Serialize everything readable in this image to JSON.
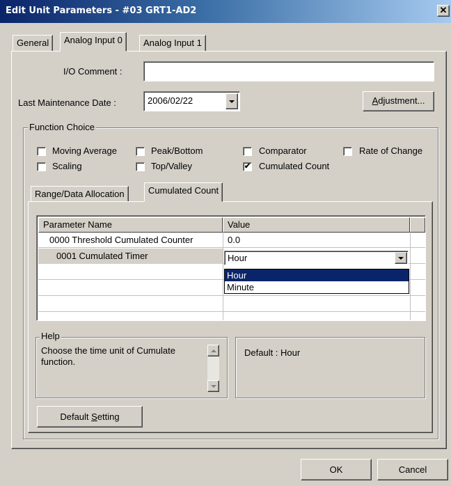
{
  "window": {
    "title": "Edit Unit Parameters - #03 GRT1-AD2",
    "close_glyph": "✕"
  },
  "tabs": [
    {
      "label": "General"
    },
    {
      "label": "Analog Input 0"
    },
    {
      "label": "Analog Input 1"
    }
  ],
  "io_comment": {
    "label": "I/O Comment :",
    "value": ""
  },
  "maintenance": {
    "label": "Last Maintenance Date :",
    "value": "2006/02/22"
  },
  "adjustment_button": {
    "pre": "",
    "mnemonic": "A",
    "post": "djustment..."
  },
  "function_choice": {
    "title": "Function Choice",
    "options": [
      {
        "label": "Moving Average",
        "checked": false
      },
      {
        "label": "Peak/Bottom",
        "checked": false
      },
      {
        "label": "Comparator",
        "checked": false
      },
      {
        "label": "Rate of Change",
        "checked": false
      },
      {
        "label": "Scaling",
        "checked": false
      },
      {
        "label": "Top/Valley",
        "checked": false
      },
      {
        "label": "Cumulated Count",
        "checked": true
      }
    ]
  },
  "subtabs": [
    {
      "label": "Range/Data Allocation"
    },
    {
      "label": "Cumulated Count"
    }
  ],
  "grid": {
    "headers": [
      "Parameter Name",
      "Value"
    ],
    "rows": [
      {
        "name": "0000 Threshold Cumulated Counter",
        "value": "0.0"
      },
      {
        "name": "0001 Cumulated Timer",
        "value": "Hour"
      }
    ],
    "dropdown_options": [
      {
        "label": "Hour",
        "selected": true
      },
      {
        "label": "Minute",
        "selected": false
      }
    ]
  },
  "help": {
    "title": "Help",
    "text": "Choose the time unit of Cumulate function.",
    "default_text": "Default : Hour"
  },
  "default_setting_button": {
    "pre": "Default ",
    "mnemonic": "S",
    "post": "etting"
  },
  "ok_button": "OK",
  "cancel_button": "Cancel",
  "check_glyph": "✔"
}
